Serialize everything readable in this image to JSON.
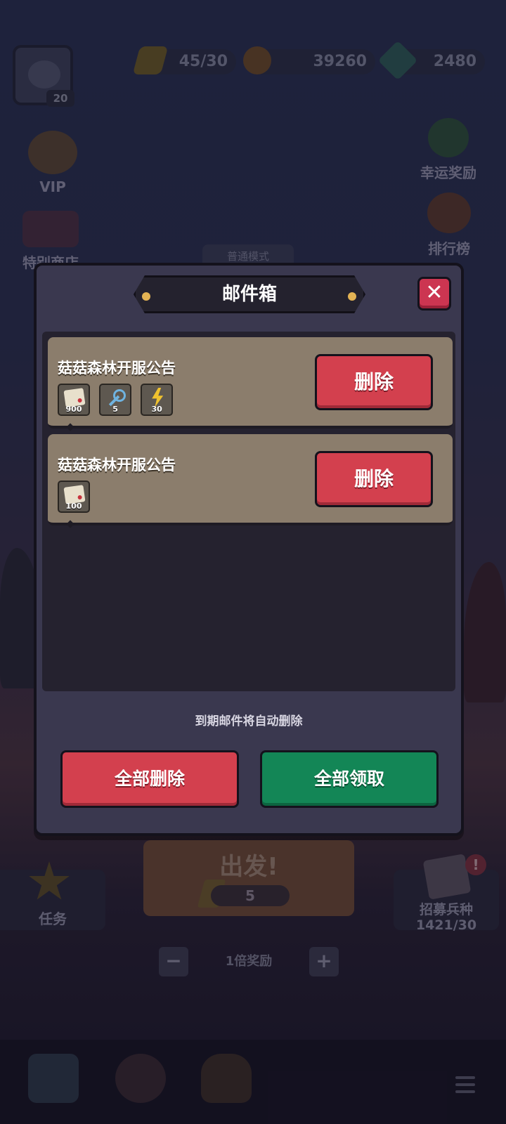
{
  "player": {
    "level": "20"
  },
  "resources": [
    {
      "name": "energy",
      "icon": "lightning-icon",
      "value": "45/30"
    },
    {
      "name": "gold",
      "icon": "coin-pouch-icon",
      "value": "39260"
    },
    {
      "name": "gems",
      "icon": "gem-icon",
      "value": "2480"
    }
  ],
  "side_left": {
    "vip": "VIP",
    "shop": "特别商店"
  },
  "side_right": {
    "lucky": "幸运奖励",
    "rank": "排行榜"
  },
  "mode_tab": "普通模式",
  "mailbox": {
    "title": "邮件箱",
    "close_icon": "close-icon",
    "mails": [
      {
        "title": "菇菇森林开服公告",
        "delete_label": "删除",
        "attachments": [
          {
            "icon": "scroll-icon",
            "qty": "900"
          },
          {
            "icon": "key-icon",
            "qty": "5"
          },
          {
            "icon": "lightning-icon",
            "qty": "30"
          }
        ]
      },
      {
        "title": "菇菇森林开服公告",
        "delete_label": "删除",
        "attachments": [
          {
            "icon": "scroll-icon",
            "qty": "100"
          }
        ]
      }
    ],
    "note": "到期邮件将自动删除",
    "delete_all_label": "全部删除",
    "claim_all_label": "全部领取"
  },
  "start": {
    "label": "出发!",
    "cost": "5"
  },
  "task": {
    "label": "任务"
  },
  "recruit": {
    "label": "招募兵种",
    "count": "1421/30"
  },
  "multiplier": {
    "label": "1倍奖励",
    "minus": "−",
    "plus": "+"
  },
  "colors": {
    "delete_red": "#d3404e",
    "claim_green": "#138656",
    "close_red": "#cc3551",
    "mail_card": "#8b7d6c",
    "modal_bg": "#3a384f"
  }
}
